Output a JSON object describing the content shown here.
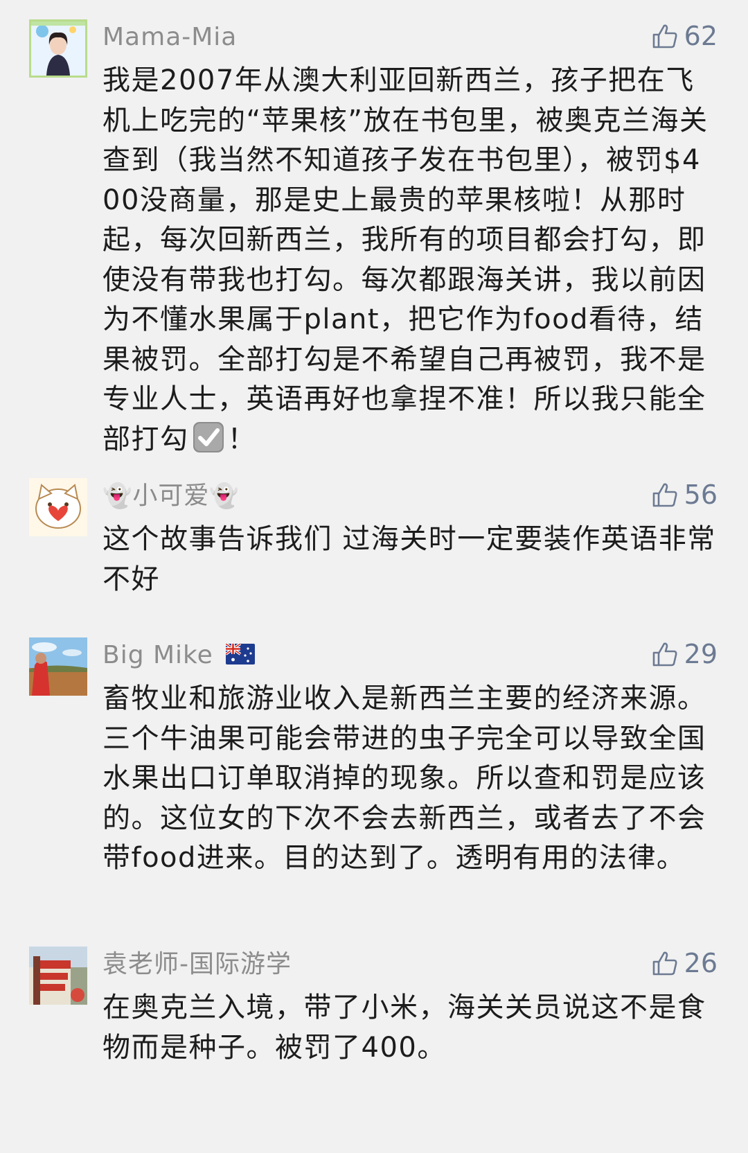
{
  "comments": [
    {
      "username": "Mama-Mia",
      "likes": "62",
      "text_before": "我是2007年从澳大利亚回新西兰，孩子把在飞机上吃完的“苹果核”放在书包里，被奥克兰海关查到（我当然不知道孩子发在书包里），被罚$400没商量，那是史上最贵的苹果核啦！从那时起，每次回新西兰，我所有的项目都会打勾，即使没有带我也打勾。每次都跟海关讲，我以前因为不懂水果属于plant，把它作为food看待，结果被罚。全部打勾是不希望自己再被罚，我不是专业人士，英语再好也拿捏不准！所以我只能全部打勾",
      "text_after": "！"
    },
    {
      "username_prefix_emoji": "👻",
      "username": "小可爱",
      "username_suffix_emoji": "👻",
      "likes": "56",
      "text": "这个故事告诉我们 过海关时一定要装作英语非常不好"
    },
    {
      "username": "Big Mike",
      "likes": "29",
      "text": "畜牧业和旅游业收入是新西兰主要的经济来源。三个牛油果可能会带进的虫子完全可以导致全国水果出口订单取消掉的现象。所以查和罚是应该的。这位女的下次不会去新西兰，或者去了不会带food进来。目的达到了。透明有用的法律。"
    },
    {
      "username": "袁老师-国际游学",
      "likes": "26",
      "text": "在奥克兰入境，带了小米，海关关员说这不是食物而是种子。被罚了400。"
    }
  ],
  "colors": {
    "background": "#f1f1f1",
    "username": "#8c8c8c",
    "likes": "#6c7a92",
    "body_text": "#1c1c1c"
  },
  "icons": {
    "like": "thumbs-up-icon",
    "check": "check-mark-button-icon",
    "flag": "australia-flag-icon"
  }
}
